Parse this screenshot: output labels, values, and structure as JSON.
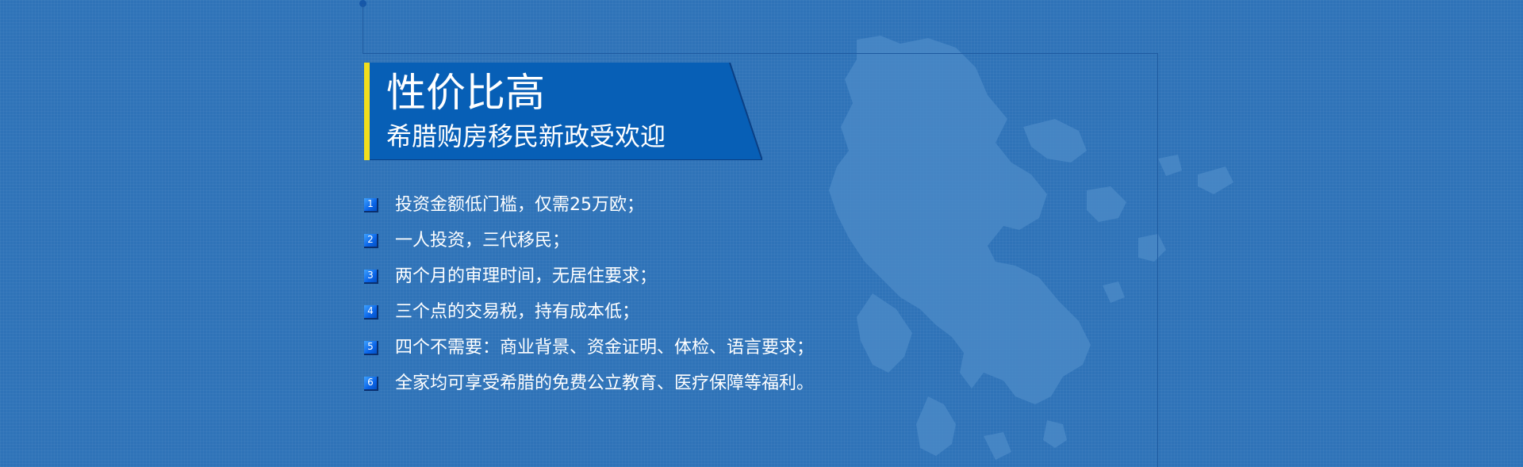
{
  "colors": {
    "background": "#2f73b8",
    "banner": "#075fb6",
    "accent": "#f1de1c",
    "badge": "#0a64e8",
    "text": "#ffffff"
  },
  "decoration": {
    "map_icon": "greece-map-icon"
  },
  "banner": {
    "title": "性价比高",
    "subtitle": "希腊购房移民新政受欢迎"
  },
  "features": [
    {
      "num": "1",
      "text": "投资金额低门槛，仅需25万欧；"
    },
    {
      "num": "2",
      "text": "一人投资，三代移民；"
    },
    {
      "num": "3",
      "text": "两个月的审理时间，无居住要求；"
    },
    {
      "num": "4",
      "text": "三个点的交易税，持有成本低；"
    },
    {
      "num": "5",
      "text": "四个不需要：商业背景、资金证明、体检、语言要求；"
    },
    {
      "num": "6",
      "text": "全家均可享受希腊的免费公立教育、医疗保障等福利。"
    }
  ]
}
